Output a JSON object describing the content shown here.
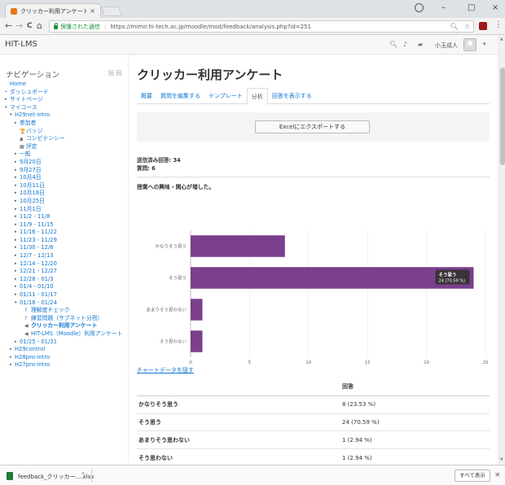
{
  "browser": {
    "tab_title": "クリッカー利用アンケート",
    "tab_close": "×",
    "controls": {
      "minimize": "–",
      "maximize": "□",
      "close": "×"
    },
    "nav": {
      "back": "←",
      "forward": "→",
      "reload": "C",
      "home": "⌂"
    },
    "secure_label": "保護された通信",
    "url": "https://mimir.hi-tech.ac.jp/moodle/mod/feedback/analysis.php?id=251",
    "menu": "⋮"
  },
  "header": {
    "site_name": "HIT-LMS",
    "user_name": "小玉成人"
  },
  "sidebar": {
    "title": "ナビゲーション",
    "tools": "回 回",
    "items": [
      {
        "label": "Home",
        "caret": "",
        "icon": "",
        "level": 0
      },
      {
        "label": "ダッシュボード",
        "caret": "•",
        "icon": "",
        "level": 0
      },
      {
        "label": "サイトページ",
        "caret": "▸",
        "icon": "",
        "level": 0
      },
      {
        "label": "マイコース",
        "caret": "▾",
        "icon": "",
        "level": 0
      },
      {
        "label": "H29net-intro",
        "caret": "▾",
        "icon": "",
        "level": 1
      },
      {
        "label": "参加者",
        "caret": "▸",
        "icon": "",
        "level": 2
      },
      {
        "label": "バッジ",
        "caret": "",
        "icon": "badge",
        "level": 2
      },
      {
        "label": "コンピテンシー",
        "caret": "",
        "icon": "competency",
        "level": 2
      },
      {
        "label": "評定",
        "caret": "",
        "icon": "grades",
        "level": 2
      },
      {
        "label": "一般",
        "caret": "▸",
        "icon": "",
        "level": 2
      },
      {
        "label": "9月20日",
        "caret": "▸",
        "icon": "",
        "level": 2
      },
      {
        "label": "9月27日",
        "caret": "▸",
        "icon": "",
        "level": 2
      },
      {
        "label": "10月4日",
        "caret": "▸",
        "icon": "",
        "level": 2
      },
      {
        "label": "10月11日",
        "caret": "▸",
        "icon": "",
        "level": 2
      },
      {
        "label": "10月18日",
        "caret": "▸",
        "icon": "",
        "level": 2
      },
      {
        "label": "10月25日",
        "caret": "▸",
        "icon": "",
        "level": 2
      },
      {
        "label": "11月1日",
        "caret": "▸",
        "icon": "",
        "level": 2
      },
      {
        "label": "11/2 - 11/8",
        "caret": "▸",
        "icon": "",
        "level": 2
      },
      {
        "label": "11/9 - 11/15",
        "caret": "▸",
        "icon": "",
        "level": 2
      },
      {
        "label": "11/16 - 11/22",
        "caret": "▸",
        "icon": "",
        "level": 2
      },
      {
        "label": "11/23 - 11/29",
        "caret": "▸",
        "icon": "",
        "level": 2
      },
      {
        "label": "11/30 - 12/6",
        "caret": "▸",
        "icon": "",
        "level": 2
      },
      {
        "label": "12/7 - 12/13",
        "caret": "▸",
        "icon": "",
        "level": 2
      },
      {
        "label": "12/14 - 12/20",
        "caret": "▸",
        "icon": "",
        "level": 2
      },
      {
        "label": "12/21 - 12/27",
        "caret": "▸",
        "icon": "",
        "level": 2
      },
      {
        "label": "12/28 - 01/3",
        "caret": "▸",
        "icon": "",
        "level": 2
      },
      {
        "label": "01/4 - 01/10",
        "caret": "▸",
        "icon": "",
        "level": 2
      },
      {
        "label": "01/11 - 01/17",
        "caret": "▸",
        "icon": "",
        "level": 2
      },
      {
        "label": "01/18 - 01/24",
        "caret": "▾",
        "icon": "",
        "level": 2
      },
      {
        "label": "理解度チェック",
        "caret": "",
        "icon": "quiz",
        "level": 3
      },
      {
        "label": "練習問題（サブネット分割）",
        "caret": "",
        "icon": "quiz",
        "level": 3
      },
      {
        "label": "クリッカー利用アンケート",
        "caret": "",
        "icon": "feedback",
        "level": 3,
        "active": true
      },
      {
        "label": "HIT-LMS（Moodle）利用アンケート",
        "caret": "",
        "icon": "feedback",
        "level": 3
      },
      {
        "label": "01/25 - 01/31",
        "caret": "▸",
        "icon": "",
        "level": 2
      },
      {
        "label": "H29control",
        "caret": "▸",
        "icon": "",
        "level": 1
      },
      {
        "label": "H28pro-intro",
        "caret": "▸",
        "icon": "",
        "level": 1
      },
      {
        "label": "H27pro-intro",
        "caret": "▸",
        "icon": "",
        "level": 1
      }
    ]
  },
  "main": {
    "title": "クリッカー利用アンケート",
    "tabs": [
      {
        "label": "概要",
        "active": false
      },
      {
        "label": "質問を編集する",
        "active": false
      },
      {
        "label": "テンプレート",
        "active": false
      },
      {
        "label": "分析",
        "active": true
      },
      {
        "label": "回答を表示する",
        "active": false
      }
    ],
    "export_button": "Excelにエクスポートする",
    "submitted": "送信済み回答: 34",
    "questions": "質問: 6",
    "question_text": "授業への興味・関心が増した。",
    "show_chart_data": "チャートデータを隠す",
    "table": {
      "header": "回答",
      "rows": [
        {
          "label": "かなりそう思う",
          "value": "8 (23.53 %)"
        },
        {
          "label": "そう思う",
          "value": "24 (70.59 %)"
        },
        {
          "label": "あまりそう思わない",
          "value": "1 (2.94 %)"
        },
        {
          "label": "そう思わない",
          "value": "1 (2.94 %)"
        }
      ]
    }
  },
  "chart_data": {
    "type": "bar",
    "orientation": "horizontal",
    "legend": "回答",
    "legend_position": "top",
    "categories": [
      "かなりそう思う",
      "そう思う",
      "あまりそう思わない",
      "そう思わない"
    ],
    "values": [
      8,
      24,
      1,
      1
    ],
    "xlim": [
      0,
      25
    ],
    "xticks": [
      0,
      5,
      10,
      15,
      20,
      25
    ],
    "color": "#7b3f8c",
    "tooltip": {
      "title": "そう思う",
      "value": "24 (70.59 %)"
    }
  },
  "downloads": {
    "file_name": "feedback_クリッカー....xlsx",
    "show_all": "すべて表示",
    "close": "×"
  }
}
